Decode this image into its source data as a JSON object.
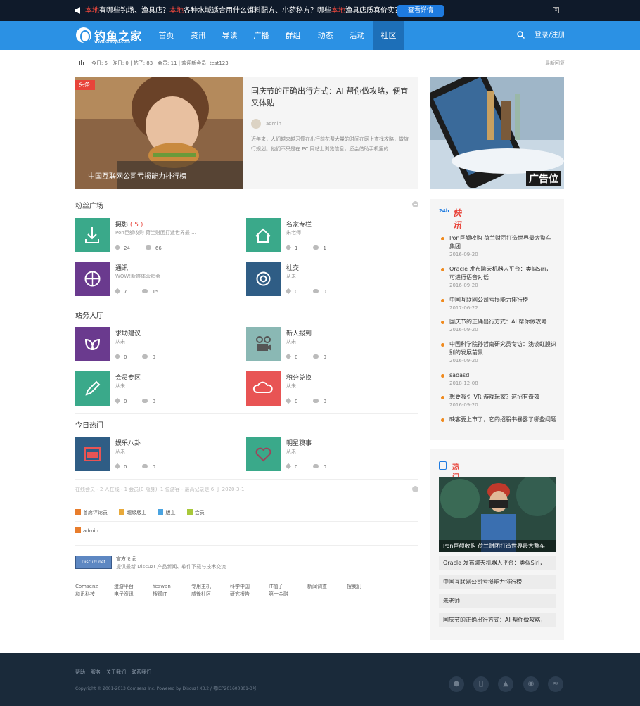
{
  "topbar": {
    "segments": [
      {
        "text": "本地",
        "hl": true
      },
      {
        "text": "有哪些钓场、渔具店？",
        "hl": false
      },
      {
        "text": "本地",
        "hl": true
      },
      {
        "text": "各种水域适合用什么饵料配方、小药秘方？哪些",
        "hl": false
      },
      {
        "text": "本地",
        "hl": true
      },
      {
        "text": "渔具店质真价实？",
        "hl": false
      }
    ],
    "button": "查看详情",
    "close": "×"
  },
  "logo": {
    "name": "钓鱼之家",
    "url": "www.diaoyu.com"
  },
  "nav": {
    "items": [
      "首页",
      "资讯",
      "导读",
      "广播",
      "群组",
      "动态",
      "活动",
      "社区"
    ],
    "active": "社区",
    "login": "登录/注册"
  },
  "stats": {
    "text": "今日: 5 | 昨日: 0 | 帖子: 83 | 会员: 11 | 欢迎新会员: test123",
    "right": "最新回复"
  },
  "hero": {
    "tag": "头条",
    "caption": "中国互联网公司亏损能力排行榜"
  },
  "hero_article": {
    "title": "国庆节的正确出行方式：AI 帮你做攻略，便宜又体贴",
    "author": "admin",
    "desc": "近年来，人们越来越习惯在出行前花费大量的时间在网上查找攻略，做旅行规划。他们不只是在 PC 网站上浏览信息，还会借助手机里的 ..."
  },
  "ad": {
    "label": "广告位"
  },
  "sections": [
    {
      "title": "粉丝广场",
      "forums": [
        {
          "name": "摄影",
          "count": "( 5 )",
          "desc": "Pon巨额收购 荷兰财团打造世界最 ...",
          "threads": "24",
          "posts": "66",
          "color": "#3aa98a"
        },
        {
          "name": "名家专栏",
          "count": "",
          "desc": "朱老师",
          "threads": "1",
          "posts": "1",
          "color": "#3aa98a"
        },
        {
          "name": "通讯",
          "count": "",
          "desc": "WOW!新媒体营销会",
          "threads": "7",
          "posts": "15",
          "color": "#6a3a8e"
        },
        {
          "name": "社交",
          "count": "",
          "desc": "从未",
          "threads": "0",
          "posts": "0",
          "color": "#2f5d85"
        }
      ]
    },
    {
      "title": "站务大厅",
      "forums": [
        {
          "name": "求助建议",
          "count": "",
          "desc": "从未",
          "threads": "0",
          "posts": "0",
          "color": "#6a3a8e"
        },
        {
          "name": "新人报到",
          "count": "",
          "desc": "从未",
          "threads": "0",
          "posts": "0",
          "color": "#8ab8b4"
        },
        {
          "name": "会员专区",
          "count": "",
          "desc": "从未",
          "threads": "0",
          "posts": "0",
          "color": "#3aa98a"
        },
        {
          "name": "积分兑换",
          "count": "",
          "desc": "从未",
          "threads": "0",
          "posts": "0",
          "color": "#e85454"
        }
      ]
    },
    {
      "title": "今日热门",
      "forums": [
        {
          "name": "娱乐八卦",
          "count": "",
          "desc": "从未",
          "threads": "0",
          "posts": "0",
          "color": "#2f5d85"
        },
        {
          "name": "明星糗事",
          "count": "",
          "desc": "从未",
          "threads": "0",
          "posts": "0",
          "color": "#3aa98a"
        }
      ]
    }
  ],
  "online": "在线会员 - 2 人在线 - 1 会员(0 隐身), 1 位游客 - 最高记录是 6 于 2020-3-1",
  "legend": [
    {
      "label": "首席评论员",
      "color": "#e87d2c"
    },
    {
      "label": "超级版主",
      "color": "#e8a93a"
    },
    {
      "label": "版主",
      "color": "#4aa3e0"
    },
    {
      "label": "会员",
      "color": "#a8c83a"
    }
  ],
  "admin": "admin",
  "official": {
    "badge": "Discuz! net",
    "title": "官方论坛",
    "desc": "提供最新 Discuz! 产品新闻、软件下载与技术交流"
  },
  "links": [
    [
      "Comsenz",
      "和讯科技"
    ],
    [
      "漫游平台",
      "电子资讯"
    ],
    [
      "Yeswan",
      "搜孤IT"
    ],
    [
      "专用主机",
      "威锋社区"
    ],
    [
      "科学中国",
      "研究报告"
    ],
    [
      "IT柚子",
      "第一金融"
    ],
    [
      "新闻调查",
      ""
    ],
    [
      "搜我们",
      ""
    ]
  ],
  "kuaixun": {
    "icon": "24h",
    "title": "快讯",
    "items": [
      {
        "title": "Pon巨额收购 荷兰财团打造世界最大整车集团",
        "date": "2016-09-20"
      },
      {
        "title": "Oracle 发布聊天机器人平台：类似Siri，可进行语音对话",
        "date": "2016-09-20"
      },
      {
        "title": "中国互联网公司亏损能力排行榜",
        "date": "2017-06-22"
      },
      {
        "title": "国庆节的正确出行方式：AI 帮你做攻略",
        "date": "2016-09-20"
      },
      {
        "title": "中国科学院孙哲南研究员专访：浅谈虹膜识别的发展前景",
        "date": "2016-09-20"
      },
      {
        "title": "sadasd",
        "date": "2018-12-08"
      },
      {
        "title": "想要吸引 VR 游戏玩家？这招有奇效",
        "date": "2016-09-20"
      },
      {
        "title": "映客要上市了，它的招股书暴露了哪些问题",
        "date": ""
      }
    ]
  },
  "hot": {
    "title": "热门专题",
    "caption": "Pon巨额收购 荷兰财团打造世界最大整车",
    "items": [
      "Oracle 发布聊天机器人平台：类似Siri，",
      "中国互联网公司亏损能力排行榜",
      "朱老师",
      "国庆节的正确出行方式：AI 帮你做攻略，"
    ]
  },
  "footer": {
    "links": [
      "帮助",
      "服务",
      "关于我们",
      "联系我们"
    ],
    "copyright": "Copyright © 2001-2013 Comsenz Inc. Powered by Discuz! X3.2 / 粤ICP201600801-3号",
    "social": [
      "wechat-icon",
      "apple-icon",
      "android-icon",
      "weibo-icon",
      "rss-icon"
    ]
  }
}
